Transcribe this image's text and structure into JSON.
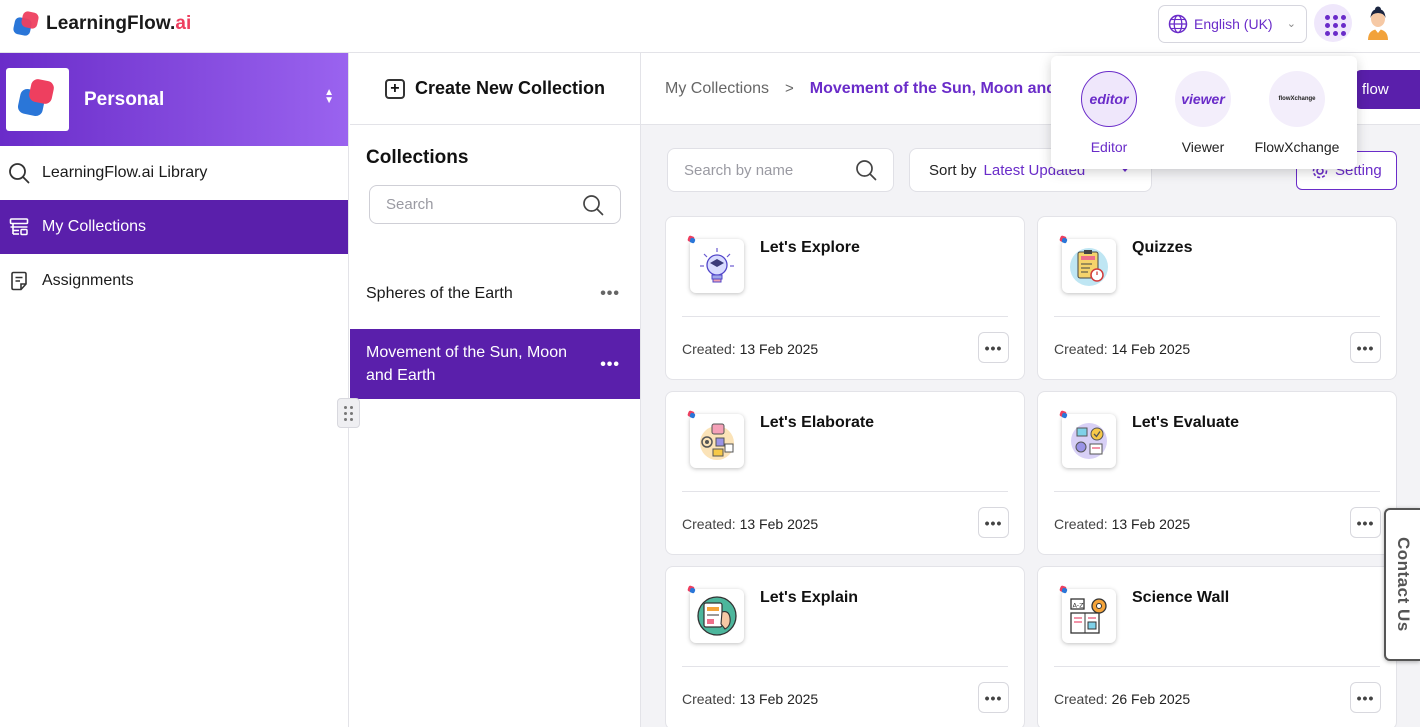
{
  "app": {
    "brand_main": "LearningFlow.",
    "brand_suffix": "ai",
    "language": "English (UK)"
  },
  "apps_menu": {
    "items": [
      {
        "label": "Editor",
        "logo_text": "editor",
        "color": "#6a2cc9"
      },
      {
        "label": "Viewer",
        "logo_text": "viewer",
        "color": "#6a2cc9"
      },
      {
        "label": "FlowXchange",
        "logo_text": "flowXchange",
        "color": "#222"
      }
    ]
  },
  "sidebar": {
    "workspace_name": "Personal",
    "items": [
      {
        "label": "LearningFlow.ai Library",
        "icon": "search-icon",
        "active": false
      },
      {
        "label": "My Collections",
        "icon": "collections-icon",
        "active": true
      },
      {
        "label": "Assignments",
        "icon": "assignment-icon",
        "active": false
      }
    ]
  },
  "collections": {
    "create_label": "Create New Collection",
    "title": "Collections",
    "search_placeholder": "Search",
    "items": [
      {
        "label": "Spheres of the Earth",
        "active": false
      },
      {
        "label": "Movement of the Sun, Moon and Earth",
        "active": true
      }
    ]
  },
  "main": {
    "breadcrumb": [
      "My Collections",
      "Movement of the Sun, Moon and Earth"
    ],
    "breadcrumb_sep": ">",
    "flow_button": "flow",
    "search_placeholder": "Search by name",
    "sort_label": "Sort by",
    "sort_value": "Latest Updated",
    "setting_label": "Setting",
    "cards": [
      {
        "title": "Let's Explore",
        "created_label": "Created:",
        "date": "13 Feb 2025",
        "icon": "lightbulb-icon"
      },
      {
        "title": "Quizzes",
        "created_label": "Created:",
        "date": "14 Feb 2025",
        "icon": "quiz-icon"
      },
      {
        "title": "Let's Elaborate",
        "created_label": "Created:",
        "date": "13 Feb 2025",
        "icon": "elaborate-icon"
      },
      {
        "title": "Let's Evaluate",
        "created_label": "Created:",
        "date": "13 Feb 2025",
        "icon": "evaluate-icon"
      },
      {
        "title": "Let's Explain",
        "created_label": "Created:",
        "date": "13 Feb 2025",
        "icon": "explain-icon"
      },
      {
        "title": "Science Wall",
        "created_label": "Created:",
        "date": "26 Feb 2025",
        "icon": "science-wall-icon"
      }
    ]
  },
  "contact_label": "Contact Us"
}
